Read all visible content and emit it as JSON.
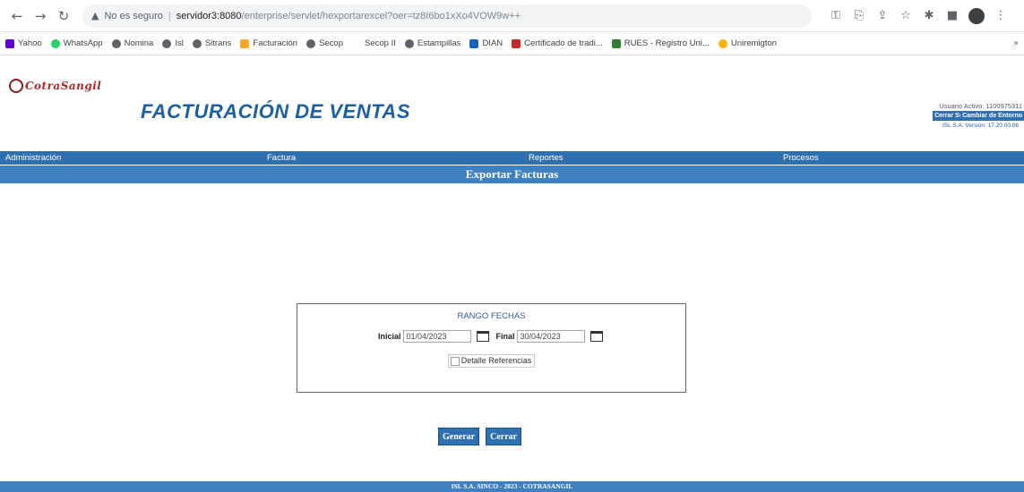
{
  "browser": {
    "url_warning": "No es seguro",
    "url_host": "servidor3:8080",
    "url_path": "/enterprise/servlet/hexportarexcel?oer=tz8I6bo1xXo4VOW9w++",
    "back_icon": "arrow-left-icon",
    "forward_icon": "arrow-right-icon",
    "reload_icon": "reload-icon"
  },
  "bookmarks": [
    {
      "label": "Yahoo",
      "color": "#6001d2"
    },
    {
      "label": "WhatsApp",
      "color": "#25d366"
    },
    {
      "label": "Nomina",
      "color": "#5f6368"
    },
    {
      "label": "Isl",
      "color": "#5f6368"
    },
    {
      "label": "Sitrans",
      "color": "#5f6368"
    },
    {
      "label": "Facturación",
      "color": "#f9a825"
    },
    {
      "label": "Secop",
      "color": "#5f6368"
    },
    {
      "label": "Secop II",
      "color": "#ffffff"
    },
    {
      "label": "Estampillas",
      "color": "#5f6368"
    },
    {
      "label": "DIAN",
      "color": "#1565c0"
    },
    {
      "label": "Certificado de tradi...",
      "color": "#c62828"
    },
    {
      "label": "RUES - Registro Uni...",
      "color": "#2e7d32"
    },
    {
      "label": "Uniremigton",
      "color": "#ffb300"
    }
  ],
  "app": {
    "logo_text": "CotraSangil",
    "title": "FACTURACIÓN DE VENTAS",
    "user_label": "Usuario Activo: 1100975311",
    "close_session": "Cerrar Sesión",
    "change_company": "Cambiar de Entorno",
    "version": "ISL S.A. Versión: 17.20.00.06",
    "menu": {
      "admin": "Administración",
      "invoice": "Factura",
      "reports": "Reportes",
      "processes": "Procesos"
    },
    "section_title": "Exportar Facturas",
    "range": {
      "title": "RANGO FECHAS",
      "start_label": "Inicial",
      "start_value": "01/04/2023",
      "end_label": "Final",
      "end_value": "30/04/2023",
      "detail_label": "Detalle Referencias"
    },
    "generate": "Generar",
    "close": "Cerrar",
    "footer": "ISL S.A. SINCO - 2023 - COTRASANGIL"
  }
}
